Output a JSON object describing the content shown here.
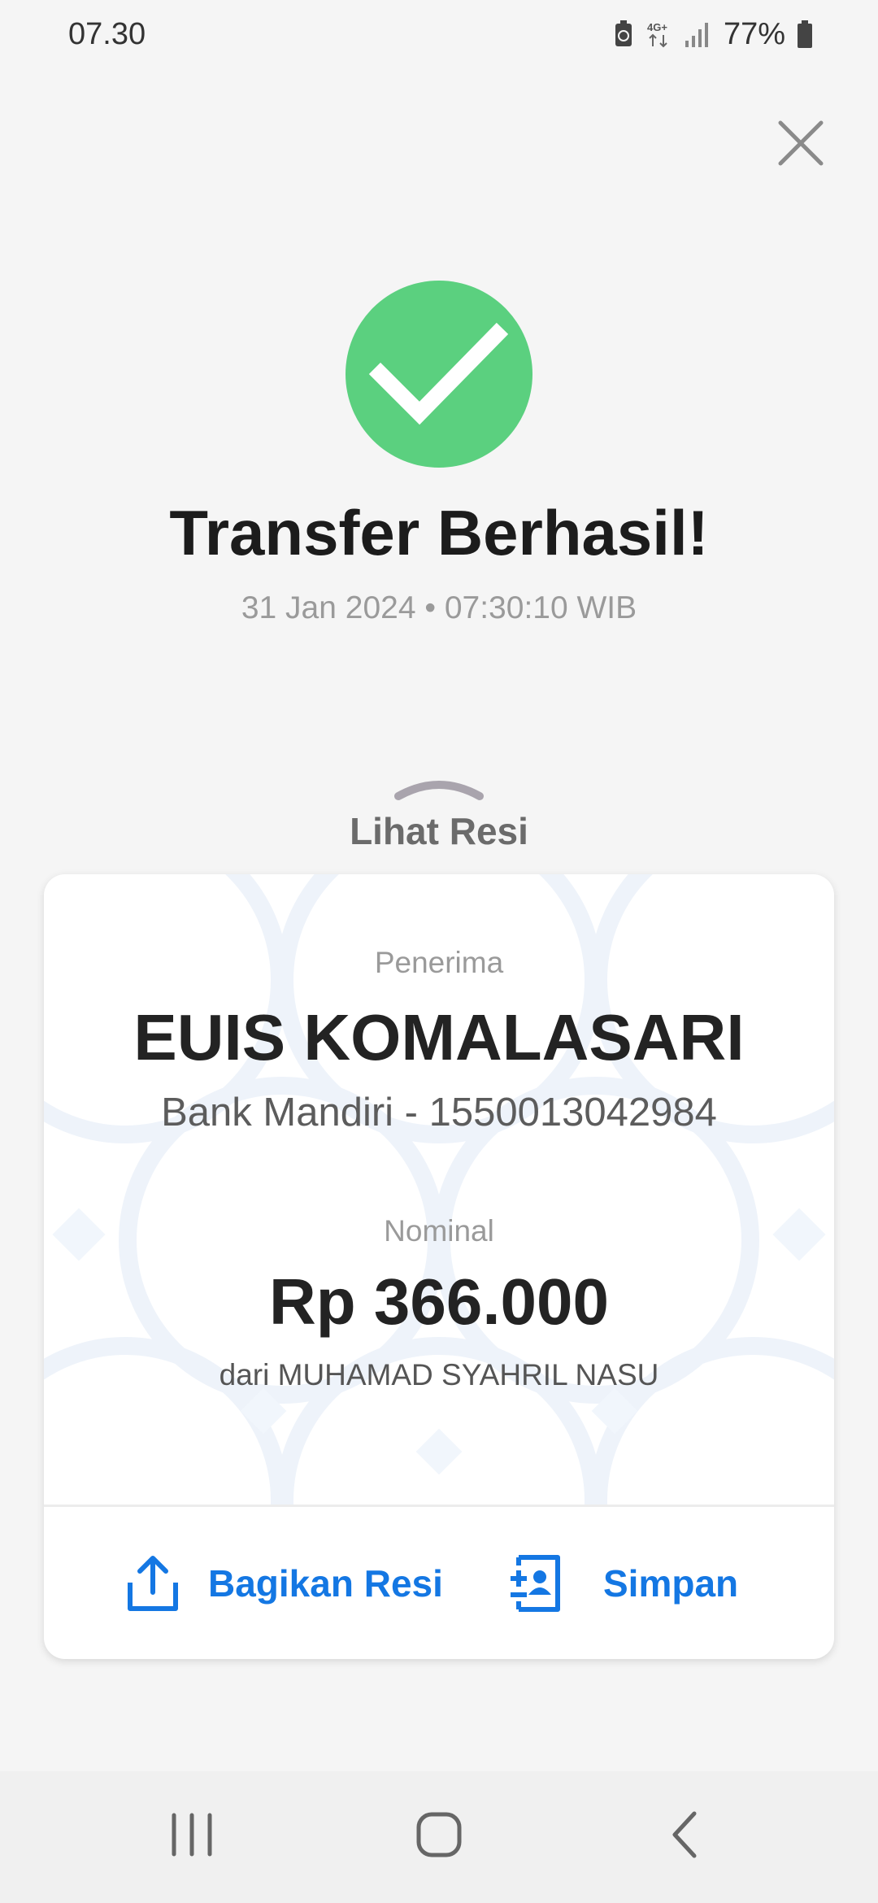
{
  "status_bar": {
    "time": "07.30",
    "network_label": "4G+",
    "battery_percent": "77%"
  },
  "success": {
    "title": "Transfer Berhasil!",
    "datetime": "31 Jan 2024 • 07:30:10 WIB",
    "accent_color": "#5bd07f"
  },
  "receipt_toggle": {
    "label": "Lihat Resi"
  },
  "receipt": {
    "recipient_label": "Penerima",
    "recipient_name": "EUIS KOMALASARI",
    "recipient_bank": "Bank Mandiri - 1550013042984",
    "amount_label": "Nominal",
    "amount": "Rp 366.000",
    "sender": "dari MUHAMAD SYAHRIL NASU"
  },
  "actions": {
    "share_label": "Bagikan Resi",
    "save_label": "Simpan",
    "accent_color": "#1477e3"
  },
  "icons": {
    "close": "close-icon",
    "check": "check-icon",
    "chevron": "chevron-up-icon",
    "share": "share-icon",
    "save": "save-contact-icon"
  }
}
